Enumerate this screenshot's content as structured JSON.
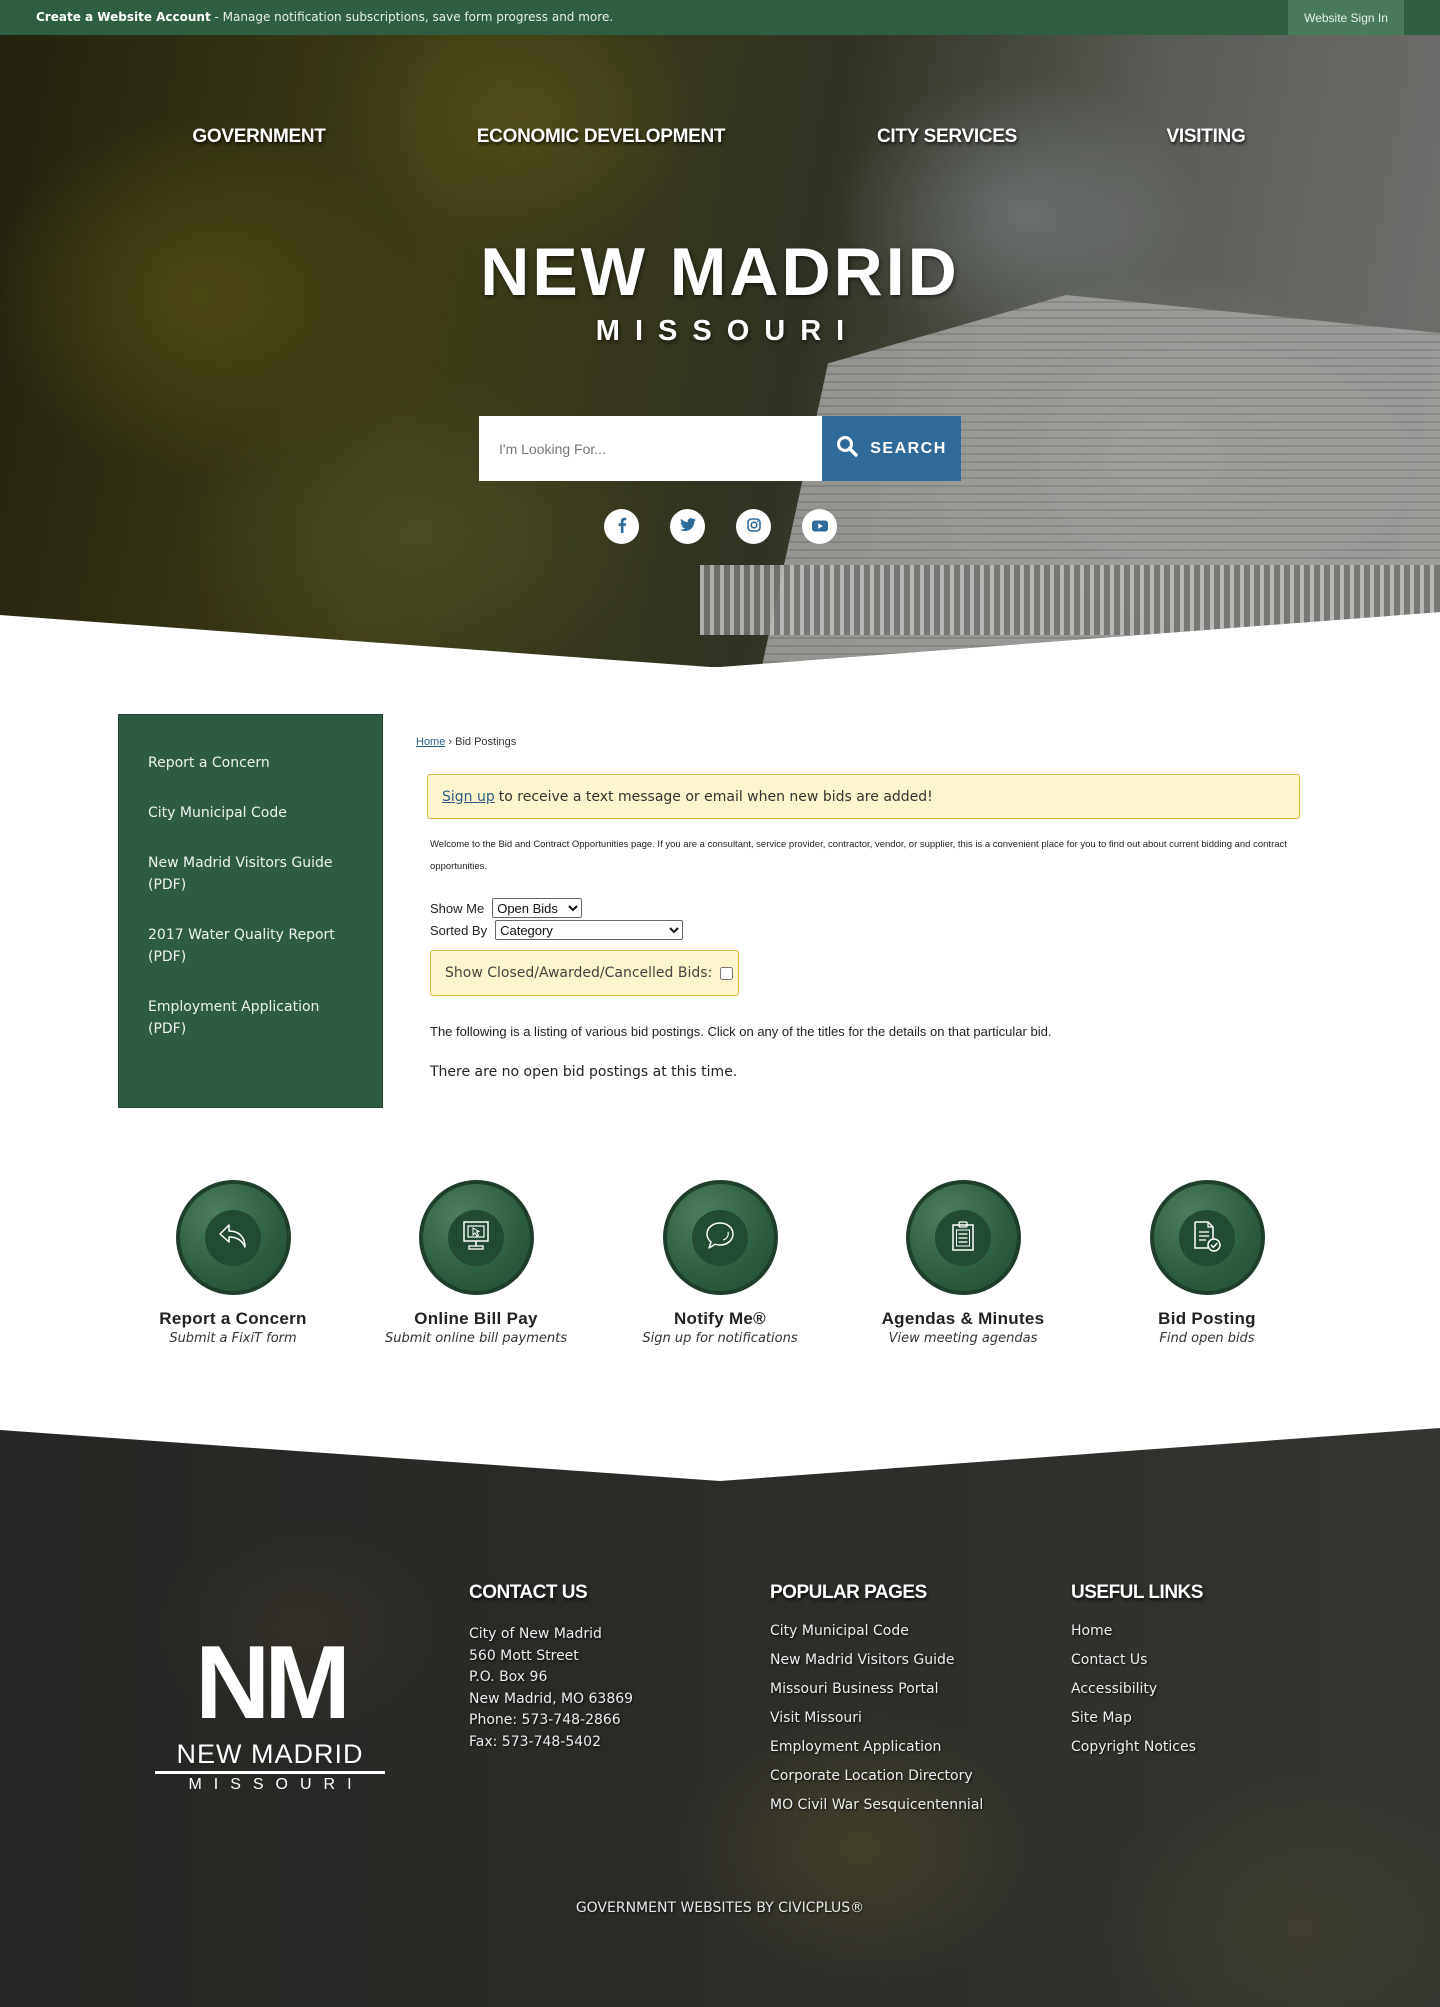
{
  "topbar": {
    "account_link": "Create a Website Account",
    "account_desc": " - Manage notification subscriptions, save form progress and more.",
    "sign_in": "Website Sign In"
  },
  "nav": {
    "items": [
      {
        "label": "GOVERNMENT"
      },
      {
        "label": "ECONOMIC DEVELOPMENT"
      },
      {
        "label": "CITY SERVICES"
      },
      {
        "label": "VISITING"
      }
    ]
  },
  "hero": {
    "title": "NEW MADRID",
    "subtitle": "MISSOURI",
    "search_placeholder": "I'm Looking For...",
    "search_button": "SEARCH",
    "social": [
      {
        "icon": "facebook-icon"
      },
      {
        "icon": "twitter-icon"
      },
      {
        "icon": "instagram-icon"
      },
      {
        "icon": "youtube-icon"
      }
    ]
  },
  "sidebar": {
    "items": [
      {
        "label": "Report a Concern"
      },
      {
        "label": "City Municipal Code"
      },
      {
        "label": "New Madrid Visitors Guide (PDF)"
      },
      {
        "label": "2017 Water Quality Report (PDF)"
      },
      {
        "label": "Employment Application (PDF)"
      }
    ]
  },
  "main": {
    "breadcrumb": {
      "home": "Home",
      "separator": "›",
      "current": "Bid Postings"
    },
    "alert": {
      "link": "Sign up",
      "text": "to receive a text message or email when new bids are added!"
    },
    "intro": "Welcome to the Bid and Contract Opportunities page. If you are a consultant, service provider, contractor, vendor, or supplier, this is a convenient place for you to find out about current bidding and contract opportunities.",
    "show_me": {
      "label": "Show Me",
      "value": "Open Bids"
    },
    "sorted_by": {
      "label": "Sorted By",
      "value": "Category"
    },
    "closed_toggle": {
      "label": "Show Closed/Awarded/Cancelled Bids:",
      "checked": false
    },
    "listing_text": "The following is a listing of various bid postings. Click on any of the titles for the details on that particular bid.",
    "empty_text": "There are no open bid postings at this time."
  },
  "quick_links": [
    {
      "title": "Report a Concern",
      "desc": "Submit a FixiT form",
      "icon": "reply-arrow-icon"
    },
    {
      "title": "Online Bill Pay",
      "desc": "Submit online bill payments",
      "icon": "computer-monitor-icon"
    },
    {
      "title": "Notify Me®",
      "desc": "Sign up for notifications",
      "icon": "speech-bubble-icon"
    },
    {
      "title": "Agendas & Minutes",
      "desc": "View meeting agendas",
      "icon": "clipboard-icon"
    },
    {
      "title": "Bid Posting",
      "desc": "Find open bids",
      "icon": "document-check-icon"
    }
  ],
  "footer": {
    "logo": {
      "monogram": "NM",
      "name": "NEW MADRID",
      "state": "MISSOURI"
    },
    "contact": {
      "heading": "CONTACT US",
      "lines": [
        "City of New Madrid",
        "560 Mott Street",
        "P.O. Box 96",
        "New Madrid, MO 63869",
        "Phone: 573-748-2866",
        "Fax: 573-748-5402"
      ]
    },
    "popular": {
      "heading": "POPULAR PAGES",
      "links": [
        "City Municipal Code",
        "New Madrid Visitors Guide",
        "Missouri Business Portal",
        "Visit Missouri",
        "Employment Application",
        "Corporate Location Directory",
        "MO Civil War Sesquicentennial"
      ]
    },
    "useful": {
      "heading": "USEFUL LINKS",
      "links": [
        "Home",
        "Contact Us",
        "Accessibility",
        "Site Map",
        "Copyright Notices"
      ]
    },
    "credit": "GOVERNMENT WEBSITES BY CIVICPLUS®"
  },
  "colors": {
    "brand_green": "#2f5e43",
    "search_blue": "#2f6b9a",
    "alert_bg": "#fdf5cb",
    "alert_border": "#d8b94a",
    "link_blue": "#2b5f8a"
  }
}
